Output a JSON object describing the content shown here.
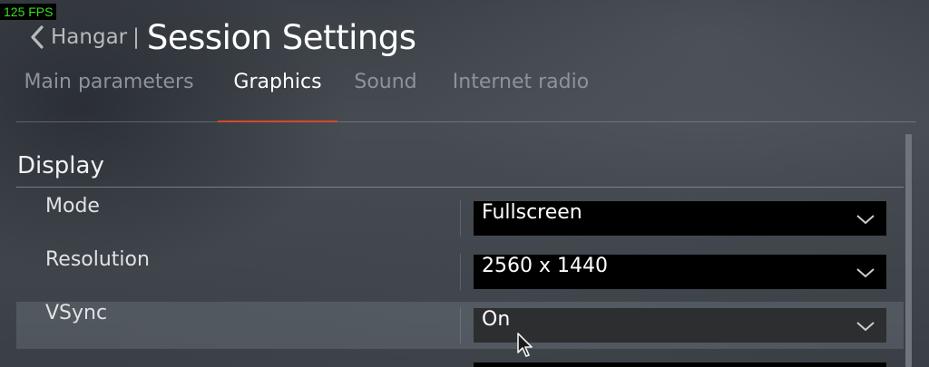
{
  "fps": "125 FPS",
  "header": {
    "back_label": "Hangar",
    "separator": "|",
    "title": "Session Settings"
  },
  "tabs": [
    {
      "label": "Main parameters",
      "active": false
    },
    {
      "label": "Graphics",
      "active": true
    },
    {
      "label": "Sound",
      "active": false
    },
    {
      "label": "Internet radio",
      "active": false
    }
  ],
  "section": {
    "title": "Display"
  },
  "settings": [
    {
      "label": "Mode",
      "value": "Fullscreen"
    },
    {
      "label": "Resolution",
      "value": "2560 x 1440"
    },
    {
      "label": "VSync",
      "value": "On",
      "highlighted": true
    }
  ],
  "colors": {
    "accent": "#d44a2a",
    "fps_text": "#37e11b",
    "select_bg": "#000000"
  },
  "icons": {
    "back": "chevron-left-icon",
    "dropdown": "chevron-down-icon",
    "cursor": "mouse-cursor-icon"
  }
}
